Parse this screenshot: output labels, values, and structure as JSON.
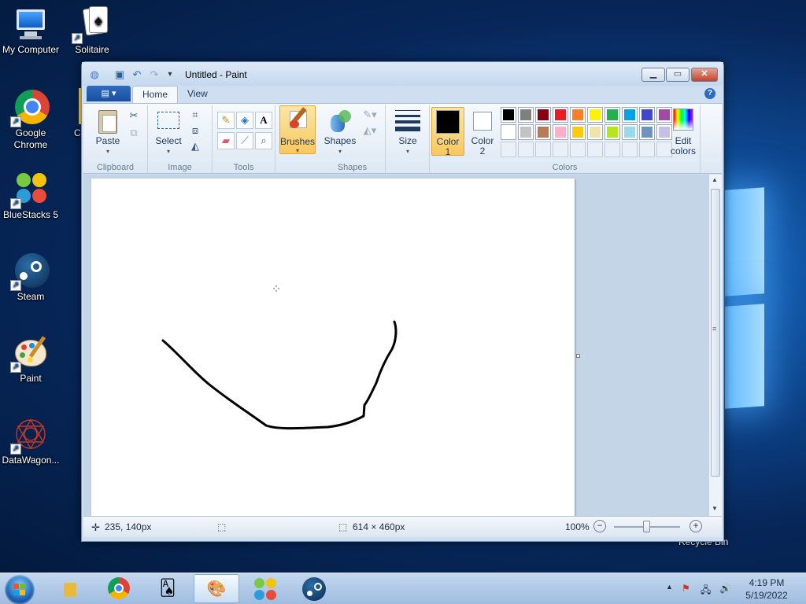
{
  "desktop": {
    "icons": [
      {
        "label": "My Computer"
      },
      {
        "label": "Solitaire"
      },
      {
        "label": "Google Chrome"
      },
      {
        "label": "BlueStacks 5"
      },
      {
        "label": "Steam"
      },
      {
        "label": "Paint"
      },
      {
        "label": "DataWagon..."
      },
      {
        "label": "C"
      }
    ],
    "recycle_bin_label": "Recycle Bin"
  },
  "window": {
    "title": "Untitled - Paint",
    "tabs": [
      {
        "label": "Home"
      },
      {
        "label": "View"
      }
    ],
    "help": "?"
  },
  "ribbon": {
    "groups": {
      "clipboard": "Clipboard",
      "image": "Image",
      "tools": "Tools",
      "shapes": "Shapes",
      "colors": "Colors"
    },
    "paste": "Paste",
    "select": "Select",
    "brushes": "Brushes",
    "shapes_btn": "Shapes",
    "size": "Size",
    "color1_a": "Color",
    "color1_b": "1",
    "color2_a": "Color",
    "color2_b": "2",
    "edit_colors_a": "Edit",
    "edit_colors_b": "colors"
  },
  "colors": {
    "color1": "#000000",
    "color2": "#ffffff",
    "palette_row1": [
      "#000000",
      "#7f7f7f",
      "#880015",
      "#ed1c24",
      "#ff7f27",
      "#fff200",
      "#22b14c",
      "#00a2e8",
      "#3f48cc",
      "#a349a4"
    ],
    "palette_row2": [
      "#ffffff",
      "#c3c3c3",
      "#b97a57",
      "#ffaec9",
      "#ffc90e",
      "#efe4b0",
      "#b5e61d",
      "#99d9ea",
      "#7092be",
      "#c8bfe7"
    ]
  },
  "status": {
    "cursor_pos": "235, 140px",
    "canvas_size": "614 × 460px",
    "zoom": "100%"
  },
  "taskbar": {
    "time": "4:19 PM",
    "date": "5/19/2022"
  }
}
